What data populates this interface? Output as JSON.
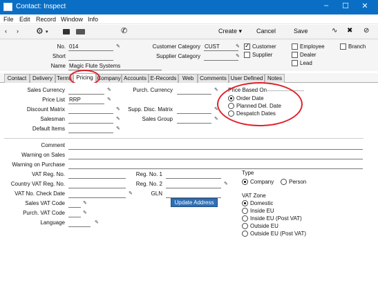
{
  "window": {
    "title": "Contact: Inspect"
  },
  "menubar": [
    "File",
    "Edit",
    "Record",
    "Window",
    "Info"
  ],
  "toolbar": {
    "create": "Create",
    "cancel": "Cancel",
    "save": "Save"
  },
  "header": {
    "no_label": "No.",
    "no_value": "014",
    "short_label": "Short",
    "short_value": "",
    "name_label": "Name",
    "name_value": "Magic Flute Systems",
    "customer_category_label": "Customer Category",
    "customer_category_value": "CUST",
    "supplier_category_label": "Supplier Category",
    "supplier_category_value": "",
    "checkboxes": {
      "customer": {
        "label": "Customer",
        "checked": true
      },
      "supplier": {
        "label": "Supplier",
        "checked": false
      },
      "employee": {
        "label": "Employee",
        "checked": false
      },
      "dealer": {
        "label": "Dealer",
        "checked": false
      },
      "lead": {
        "label": "Lead",
        "checked": false
      },
      "branch": {
        "label": "Branch",
        "checked": false
      }
    }
  },
  "tabs": [
    "Contact",
    "Delivery",
    "Terms",
    "Pricing",
    "Company",
    "Accounts",
    "E-Records",
    "Web",
    "Comments",
    "User Defined",
    "Notes"
  ],
  "active_tab": "Pricing",
  "pricing": {
    "sales_currency_label": "Sales Currency",
    "price_list_label": "Price List",
    "price_list_value": "RRP",
    "discount_matrix_label": "Discount Matrix",
    "salesman_label": "Salesman",
    "default_items_label": "Default Items",
    "purch_currency_label": "Purch. Currency",
    "supp_disc_matrix_label": "Supp. Disc. Matrix",
    "sales_group_label": "Sales Group",
    "price_based_on_label": "Price Based On",
    "price_based_on_options": [
      "Order Date",
      "Planned Del. Date",
      "Despatch Dates"
    ],
    "price_based_on_selected": "Order Date"
  },
  "lower": {
    "comment_label": "Comment",
    "warning_on_sales_label": "Warning on Sales",
    "warning_on_purchase_label": "Warning on Purchase",
    "vat_reg_no_label": "VAT Reg. No.",
    "country_vat_reg_no_label": "Country VAT Reg. No.",
    "vat_no_check_date_label": "VAT No. Check Date",
    "sales_vat_code_label": "Sales VAT Code",
    "purch_vat_code_label": "Purch. VAT Code",
    "language_label": "Language",
    "reg_no_1_label": "Reg. No. 1",
    "reg_no_2_label": "Reg. No. 2",
    "gln_label": "GLN",
    "update_address_button": "Update Address",
    "type_label": "Type",
    "type_options": [
      "Company",
      "Person"
    ],
    "type_selected": "Company",
    "vat_zone_label": "VAT Zone",
    "vat_zone_options": [
      "Domestic",
      "Inside EU",
      "Inside EU (Post VAT)",
      "Outside EU",
      "Outside EU (Post VAT)"
    ],
    "vat_zone_selected": "Domestic"
  },
  "colors": {
    "titlebar": "#0a6fc4",
    "highlight_ring": "#e0202a",
    "button": "#2f6fb4"
  }
}
